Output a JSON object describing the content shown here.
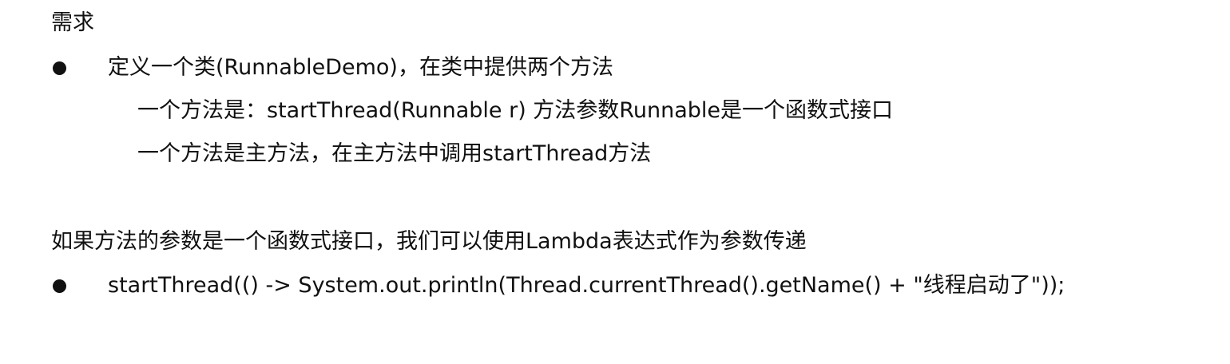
{
  "requirements": {
    "heading": "需求",
    "item1": "定义一个类(RunnableDemo)，在类中提供两个方法",
    "sub1": "一个方法是：startThread(Runnable r)   方法参数Runnable是一个函数式接口",
    "sub2": "一个方法是主方法，在主方法中调用startThread方法"
  },
  "lambda_note": {
    "text": "如果方法的参数是一个函数式接口，我们可以使用Lambda表达式作为参数传递",
    "code": "startThread(() -> System.out.println(Thread.currentThread().getName() + \"线程启动了\"));"
  }
}
